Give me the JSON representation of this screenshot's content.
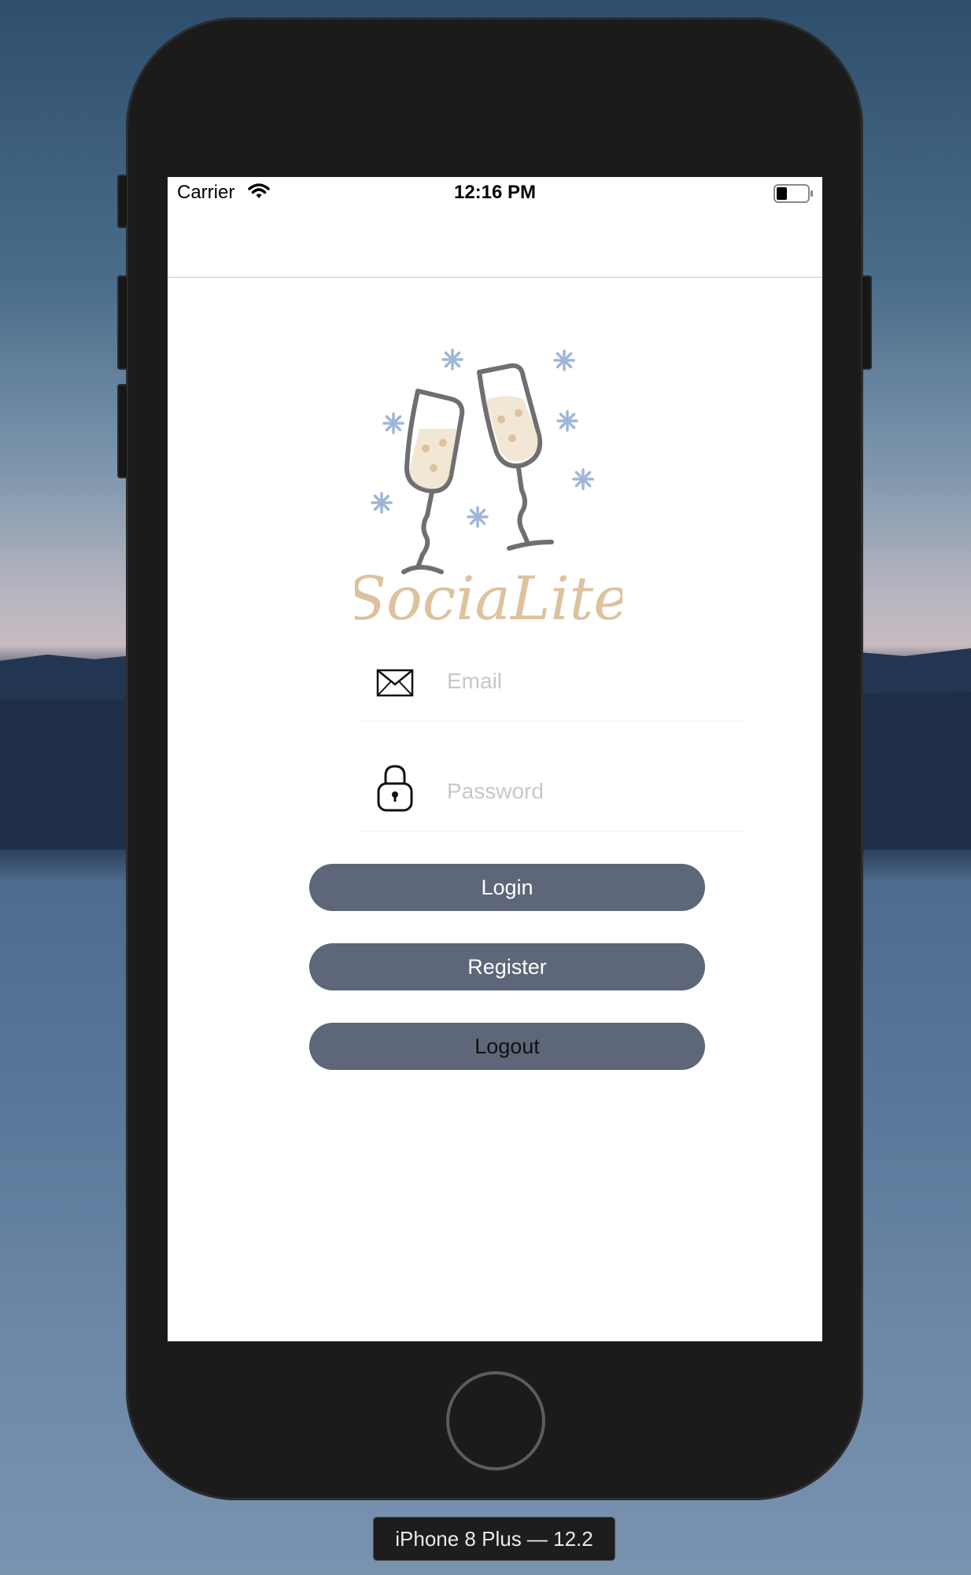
{
  "status_bar": {
    "carrier": "Carrier",
    "time": "12:16 PM"
  },
  "logo": {
    "wordmark": "SociaLite"
  },
  "form": {
    "email_placeholder": "Email",
    "password_placeholder": "Password"
  },
  "buttons": {
    "login": "Login",
    "register": "Register",
    "logout": "Logout"
  },
  "simulator": {
    "device_label": "iPhone 8 Plus — 12.2"
  },
  "icons": {
    "email": "envelope-icon",
    "password": "lock-icon",
    "wifi": "wifi-icon",
    "battery": "battery-icon"
  },
  "colors": {
    "button_bg": "#5e6679",
    "button_text_light": "#ffffff",
    "button_text_dark": "#111111",
    "logo_gold": "#dcc29d",
    "logo_snow": "#9fb6d8",
    "logo_glass": "#6f6f72"
  },
  "battery_level": 0.3
}
